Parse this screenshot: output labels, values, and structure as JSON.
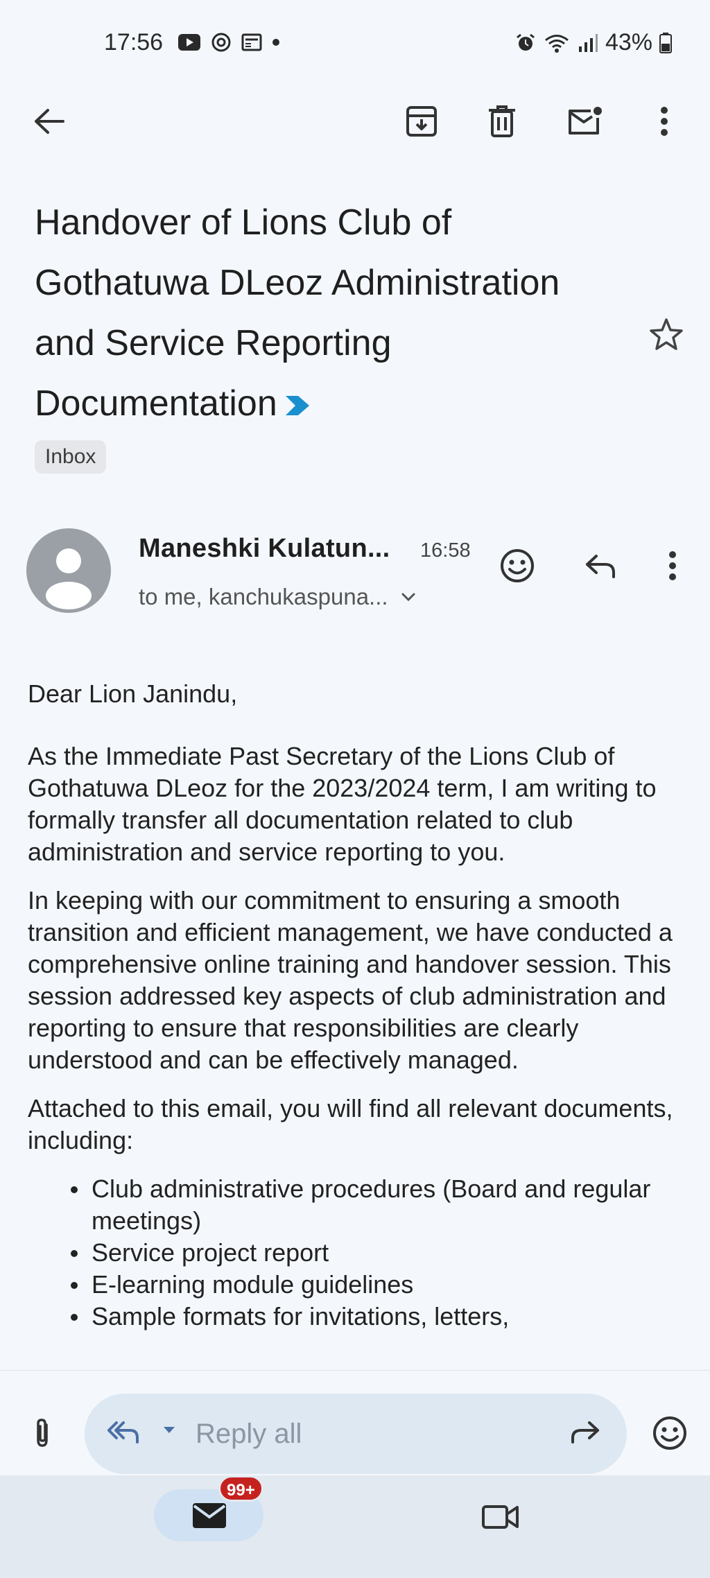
{
  "status_bar": {
    "time": "17:56",
    "battery": "43%",
    "icons": [
      "youtube-icon",
      "sync-icon",
      "news-icon",
      "dot-icon",
      "alarm-icon",
      "wifi-icon",
      "signal-icon",
      "battery-icon"
    ]
  },
  "toolbar": {
    "icons": [
      "back-arrow-icon",
      "archive-icon",
      "delete-icon",
      "mark-unread-icon",
      "more-vert-icon"
    ]
  },
  "email": {
    "subject": "Handover of Lions Club of Gothatuwa DLeoz Administration and Service Reporting Documentation",
    "label": "Inbox",
    "sender": "Maneshki Kulatun...",
    "time": "16:58",
    "recipients": "to me, kanchukaspuna...",
    "body": {
      "greeting": "Dear Lion Janindu,",
      "paragraphs": [
        "As the Immediate Past Secretary of the Lions Club of Gothatuwa DLeoz for the 2023/2024 term, I am writing to formally transfer all documentation related to club administration and service reporting to you.",
        "In keeping with our commitment to ensuring a smooth transition and efficient management, we have conducted a comprehensive online training and handover session. This session addressed key aspects of club administration and reporting to ensure that responsibilities are clearly understood and can be effectively managed.",
        "Attached to this email, you will find all relevant documents, including:"
      ],
      "list": [
        "Club administrative procedures (Board and regular meetings)",
        "Service project report",
        "E-learning module guidelines",
        "Sample formats for invitations, letters,"
      ]
    }
  },
  "reply_bar": {
    "placeholder": "Reply all"
  },
  "bottom_nav": {
    "mail_badge": "99+"
  },
  "colors": {
    "background": "#f4f8fc",
    "reply_pill": "#dde8f2",
    "badge": "#c5221f",
    "importance": "#1a8fd0",
    "avatar": "#9aa0a6"
  }
}
